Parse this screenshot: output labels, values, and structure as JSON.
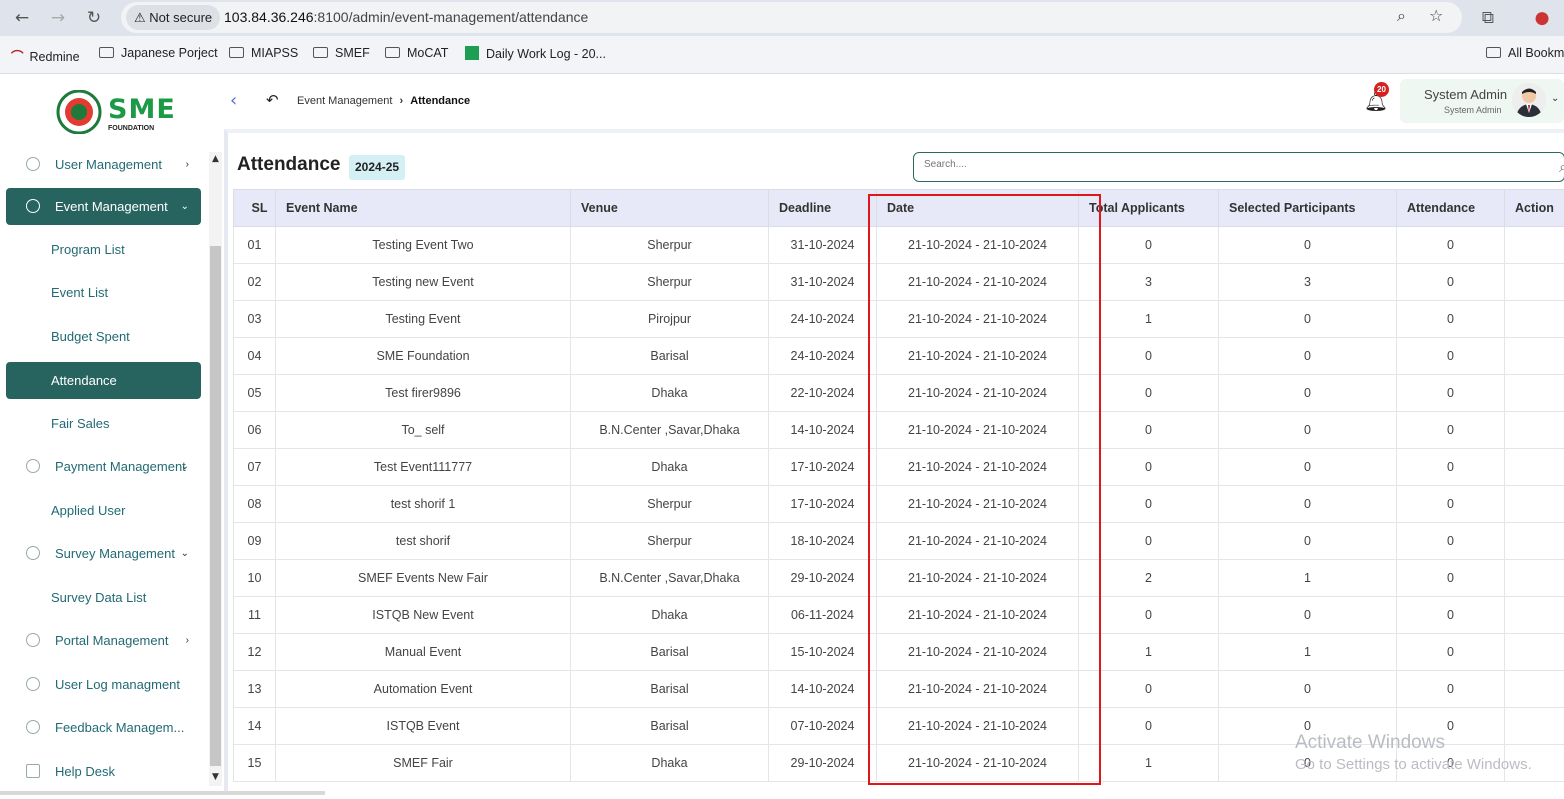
{
  "browser": {
    "security_label": "Not secure",
    "url_host": "103.84.36.246",
    "url_rest": ":8100/admin/event-management/attendance",
    "bookmarks": [
      "Redmine",
      "Japanese Porject",
      "MIAPSS",
      "SMEF",
      "MoCAT",
      "Daily Work Log - 20...",
      "All Bookm"
    ]
  },
  "logo": {
    "text": "SME",
    "sub": "FOUNDATION"
  },
  "sidebar": {
    "items": [
      {
        "label": "User Management",
        "chevron": "›"
      },
      {
        "label": "Event Management",
        "chevron": "⌄"
      },
      {
        "label": "Program List"
      },
      {
        "label": "Event List"
      },
      {
        "label": "Budget Spent"
      },
      {
        "label": "Attendance"
      },
      {
        "label": "Fair Sales"
      },
      {
        "label": "Payment Management",
        "chevron": "⌄"
      },
      {
        "label": "Applied User"
      },
      {
        "label": "Survey Management",
        "chevron": "⌄"
      },
      {
        "label": "Survey Data List"
      },
      {
        "label": "Portal Management",
        "chevron": "›"
      },
      {
        "label": "User Log managment"
      },
      {
        "label": "Feedback Managem..."
      },
      {
        "label": "Help Desk"
      }
    ]
  },
  "header": {
    "breadcrumb_parent": "Event Management",
    "breadcrumb_sep": "›",
    "breadcrumb_current": "Attendance",
    "notification_count": "20",
    "user_name": "System Admin",
    "user_role": "System Admin"
  },
  "page": {
    "title": "Attendance",
    "fiscal_year": "2024-25",
    "search_placeholder": "Search...."
  },
  "table": {
    "columns": [
      "SL",
      "Event Name",
      "Venue",
      "Deadline",
      "Date",
      "Total Applicants",
      "Selected Participants",
      "Attendance",
      "Action"
    ],
    "rows": [
      [
        "01",
        "Testing Event Two",
        "Sherpur",
        "31-10-2024",
        "21-10-2024 - 21-10-2024",
        "0",
        "0",
        "0"
      ],
      [
        "02",
        "Testing new Event",
        "Sherpur",
        "31-10-2024",
        "21-10-2024 - 21-10-2024",
        "3",
        "3",
        "0"
      ],
      [
        "03",
        "Testing Event",
        "Pirojpur",
        "24-10-2024",
        "21-10-2024 - 21-10-2024",
        "1",
        "0",
        "0"
      ],
      [
        "04",
        "SME Foundation",
        "Barisal",
        "24-10-2024",
        "21-10-2024 - 21-10-2024",
        "0",
        "0",
        "0"
      ],
      [
        "05",
        "Test firer9896",
        "Dhaka",
        "22-10-2024",
        "21-10-2024 - 21-10-2024",
        "0",
        "0",
        "0"
      ],
      [
        "06",
        "To_ self",
        "B.N.Center ,Savar,Dhaka",
        "14-10-2024",
        "21-10-2024 - 21-10-2024",
        "0",
        "0",
        "0"
      ],
      [
        "07",
        "Test Event111777",
        "Dhaka",
        "17-10-2024",
        "21-10-2024 - 21-10-2024",
        "0",
        "0",
        "0"
      ],
      [
        "08",
        "test shorif 1",
        "Sherpur",
        "17-10-2024",
        "21-10-2024 - 21-10-2024",
        "0",
        "0",
        "0"
      ],
      [
        "09",
        "test shorif",
        "Sherpur",
        "18-10-2024",
        "21-10-2024 - 21-10-2024",
        "0",
        "0",
        "0"
      ],
      [
        "10",
        "SMEF Events New Fair",
        "B.N.Center ,Savar,Dhaka",
        "29-10-2024",
        "21-10-2024 - 21-10-2024",
        "2",
        "1",
        "0"
      ],
      [
        "11",
        "ISTQB New Event",
        "Dhaka",
        "06-11-2024",
        "21-10-2024 - 21-10-2024",
        "0",
        "0",
        "0"
      ],
      [
        "12",
        "Manual Event",
        "Barisal",
        "15-10-2024",
        "21-10-2024 - 21-10-2024",
        "1",
        "1",
        "0"
      ],
      [
        "13",
        "Automation Event",
        "Barisal",
        "14-10-2024",
        "21-10-2024 - 21-10-2024",
        "0",
        "0",
        "0"
      ],
      [
        "14",
        "ISTQB Event",
        "Barisal",
        "07-10-2024",
        "21-10-2024 - 21-10-2024",
        "0",
        "0",
        "0"
      ],
      [
        "15",
        "SMEF Fair",
        "Dhaka",
        "29-10-2024",
        "21-10-2024 - 21-10-2024",
        "1",
        "0",
        "0"
      ]
    ]
  },
  "watermark": {
    "line1": "Activate Windows",
    "line2": "Go to Settings to activate Windows."
  },
  "colors": {
    "primary": "#27645f",
    "highlight": "#e0161b",
    "header_bg": "#e8e9f8",
    "badge": "#d42121"
  }
}
